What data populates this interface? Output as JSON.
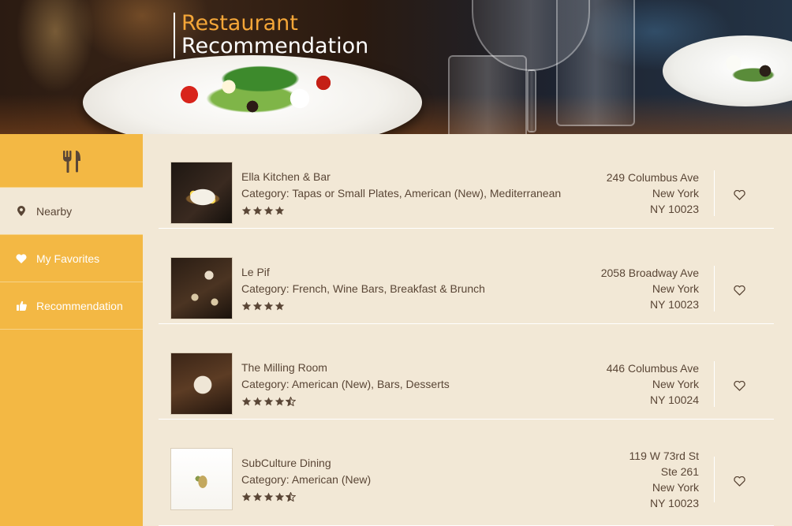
{
  "header": {
    "title_line1": "Restaurant",
    "title_line2": "Recommendation"
  },
  "sidebar": {
    "logo_icon": "fork-knife-icon",
    "items": [
      {
        "label": "Nearby",
        "icon": "map-pin-icon",
        "active": true
      },
      {
        "label": "My Favorites",
        "icon": "heart-icon",
        "active": false
      },
      {
        "label": "Recommendation",
        "icon": "thumbs-up-icon",
        "active": false
      }
    ]
  },
  "restaurants": [
    {
      "name": "Ella Kitchen & Bar",
      "category": "Category: Tapas or Small Plates, American (New), Mediterranean",
      "rating": 4,
      "address_lines": [
        "249 Columbus Ave",
        "New York",
        "NY 10023"
      ]
    },
    {
      "name": "Le Pif",
      "category": "Category: French, Wine Bars, Breakfast & Brunch",
      "rating": 4,
      "address_lines": [
        "2058 Broadway Ave",
        "New York",
        "NY 10023"
      ]
    },
    {
      "name": "The Milling Room",
      "category": "Category: American (New), Bars, Desserts",
      "rating": 4.5,
      "address_lines": [
        "446 Columbus Ave",
        "New York",
        "NY 10024"
      ]
    },
    {
      "name": "SubCulture Dining",
      "category": "Category: American (New)",
      "rating": 4.5,
      "address_lines": [
        "119 W 73rd St",
        "Ste 261",
        "New York",
        "NY 10023"
      ]
    }
  ],
  "colors": {
    "accent_orange": "#f3b844",
    "title_orange": "#f4a638",
    "content_bg": "#f2e8d6",
    "text_brown": "#5a4636"
  }
}
